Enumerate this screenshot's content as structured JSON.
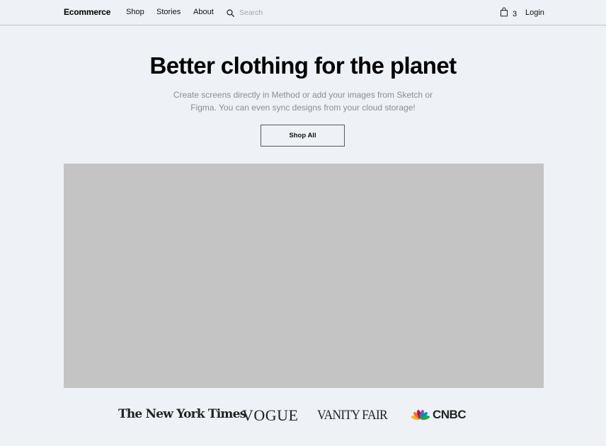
{
  "header": {
    "brand": "Ecommerce",
    "nav": [
      "Shop",
      "Stories",
      "About"
    ],
    "search_placeholder": "Search",
    "cart_count": "3",
    "login": "Login"
  },
  "hero": {
    "title": "Better clothing for the planet",
    "subtitle": "Create screens directly in Method or add your images from Sketch or Figma. You can even sync designs from your cloud storage!",
    "cta": "Shop All"
  },
  "press": {
    "logos": [
      "The New York Times",
      "VOGUE",
      "VANITY FAIR",
      "CNBC"
    ]
  },
  "colors": {
    "background": "#eef1f5",
    "image_placeholder": "#c4c4c4",
    "text": "#111111",
    "muted_text": "#8a8e93",
    "cnbc_peacock": [
      "#fcb711",
      "#f37021",
      "#cc004c",
      "#6460aa",
      "#0089d0",
      "#0db14b"
    ]
  },
  "icons": {
    "search": "search-icon",
    "cart": "shopping-bag-icon"
  }
}
